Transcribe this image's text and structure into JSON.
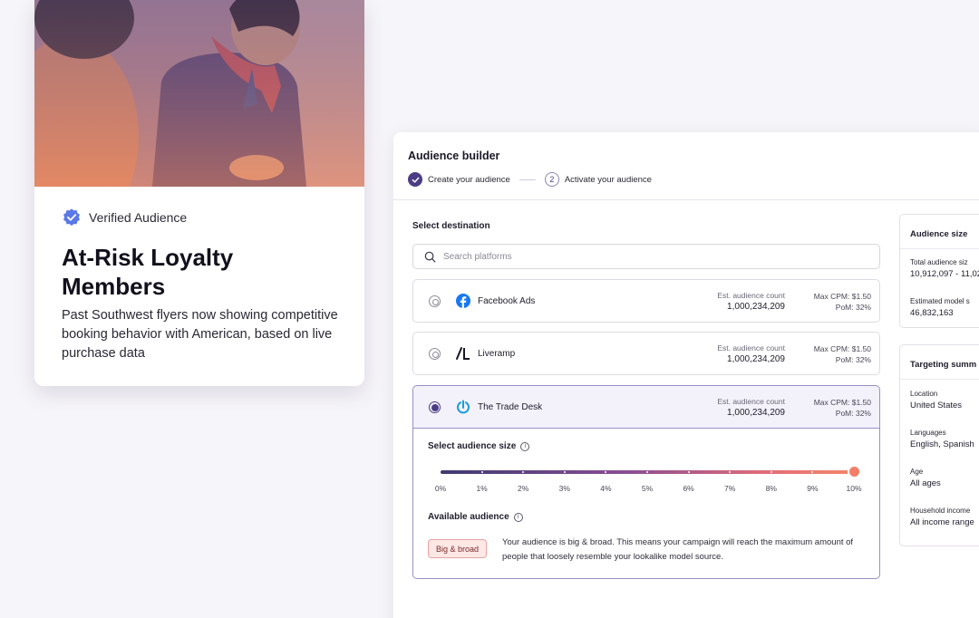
{
  "hero": {
    "verified_label": "Verified Audience",
    "title": "At-Risk Loyalty Members",
    "description": "Past Southwest flyers now showing competitive booking behavior with American, based on live purchase data"
  },
  "builder": {
    "title": "Audience builder",
    "steps": [
      {
        "label": "Create your audience",
        "state": "done"
      },
      {
        "label": "Activate your audience",
        "state": "current",
        "number": "2"
      }
    ],
    "section_label": "Select destination",
    "search_placeholder": "Search platforms",
    "platforms": [
      {
        "name": "Facebook Ads",
        "icon": "facebook-icon",
        "count_label": "Est. audience count",
        "count": "1,000,234,209",
        "cpm": "Max CPM: $1.50",
        "pom": "PoM: 32%",
        "selected": false
      },
      {
        "name": "Liveramp",
        "icon": "liveramp-icon",
        "count_label": "Est. audience count",
        "count": "1,000,234,209",
        "cpm": "Max CPM: $1.50",
        "pom": "PoM: 32%",
        "selected": false
      },
      {
        "name": "The Trade Desk",
        "icon": "trade-desk-icon",
        "count_label": "Est. audience count",
        "count": "1,000,234,209",
        "cpm": "Max CPM: $1.50",
        "pom": "PoM: 32%",
        "selected": true
      }
    ],
    "audience_size_label": "Select audience size",
    "slider_ticks": [
      "0%",
      "1%",
      "2%",
      "3%",
      "4%",
      "5%",
      "6%",
      "7%",
      "8%",
      "9%",
      "10%"
    ],
    "slider_value_percent": 10,
    "available_label": "Available audience",
    "tag": "Big & broad",
    "available_desc": "Your audience is big & broad. This means your campaign will reach the maximum amount of people that loosely resemble your lookalike model source."
  },
  "sidebar": {
    "size_card": {
      "title": "Audience size",
      "items": [
        {
          "key": "Total audience siz",
          "value": "10,912,097 - 11,02"
        },
        {
          "key": "Estimated model s",
          "value": "46,832,163"
        }
      ]
    },
    "targeting_card": {
      "title": "Targeting summ",
      "items": [
        {
          "key": "Location",
          "value": "United States"
        },
        {
          "key": "Languages",
          "value": "English, Spanish"
        },
        {
          "key": "Age",
          "value": "All ages"
        },
        {
          "key": "Household income",
          "value": "All income range"
        }
      ]
    }
  },
  "colors": {
    "accent": "#4c3c86",
    "facebook": "#1877f2",
    "tradedesk": "#1a9cd8",
    "tag_bg": "#fde8e6"
  }
}
